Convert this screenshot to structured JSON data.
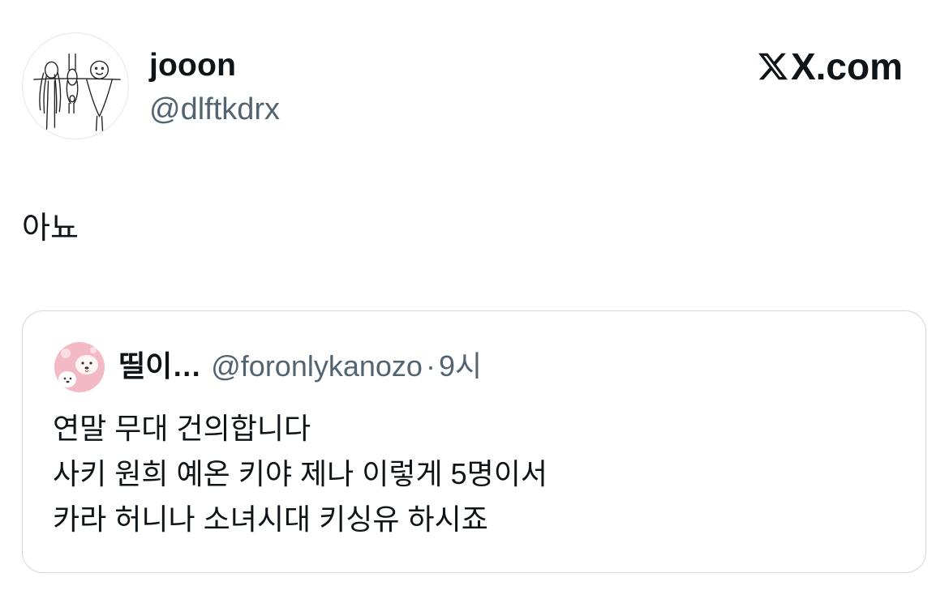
{
  "author": {
    "display_name": "jooon",
    "handle": "@dlftkdrx",
    "avatar": "stick-figure-drawing-avatar"
  },
  "brand": {
    "text": "X.com",
    "icon": "x-logo-icon"
  },
  "tweet": {
    "text": "아뇨"
  },
  "quoted_tweet": {
    "display_name": "띨이…",
    "handle": "@foronlykanozo",
    "separator": "·",
    "time": "9시",
    "avatar": "pink-puppy-avatar",
    "lines": [
      "연말 무대 건의합니다",
      "사키 원희 예온 키야 제나 이렇게 5명이서",
      "카라 허니나 소녀시대 키싱유 하시죠"
    ]
  },
  "colors": {
    "text": "#0f1419",
    "secondary": "#536471",
    "border": "#cfd9de",
    "background": "#ffffff"
  }
}
